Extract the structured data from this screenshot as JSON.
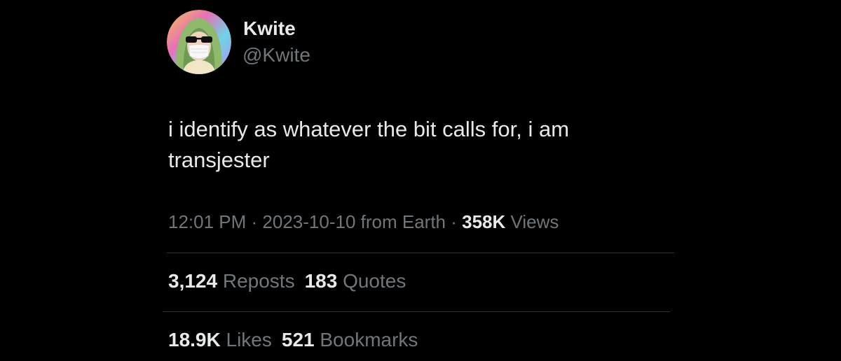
{
  "author": {
    "name": "Kwite",
    "handle": "@Kwite"
  },
  "tweet": {
    "text_line1": "i identify as whatever the bit calls for, i am",
    "text_line2": "transjester"
  },
  "meta": {
    "time": "12:01 PM",
    "separator": " · ",
    "date": "2023-10-10",
    "from_label": " from Earth",
    "views_count": "358K",
    "views_label": " Views"
  },
  "stats": {
    "reposts_count": "3,124",
    "reposts_label": "Reposts",
    "quotes_count": "183",
    "quotes_label": "Quotes",
    "likes_count": "18.9K",
    "likes_label": "Likes",
    "bookmarks_count": "521",
    "bookmarks_label": "Bookmarks"
  },
  "colors": {
    "background": "#000000",
    "primary_text": "#e7e9ea",
    "secondary_text": "#71767b",
    "divider": "#2f3336"
  }
}
